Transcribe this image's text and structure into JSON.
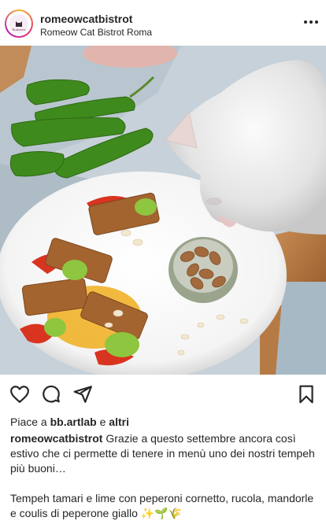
{
  "header": {
    "username": "romeowcatbistrot",
    "location": "Romeow Cat Bistrot Roma",
    "avatar_icon": "romeow-logo-icon"
  },
  "photo": {
    "subject": "food-and-cat-photo"
  },
  "actions": {
    "like_icon": "heart-icon",
    "comment_icon": "comment-icon",
    "share_icon": "send-icon",
    "save_icon": "bookmark-icon"
  },
  "likes": {
    "prefix": "Piace a",
    "user": "bb.artlab",
    "connector": "e",
    "others": "altri"
  },
  "caption": {
    "username": "romeowcatbistrot",
    "line1": "Grazie a questo settembre ancora così estivo che ci permette di tenere in menù uno dei nostri tempeh più buoni…",
    "line2": "Tempeh tamari e lime con peperoni cornetto, rucola, mandorle e coulis di peperone giallo ✨🌱🌾"
  }
}
